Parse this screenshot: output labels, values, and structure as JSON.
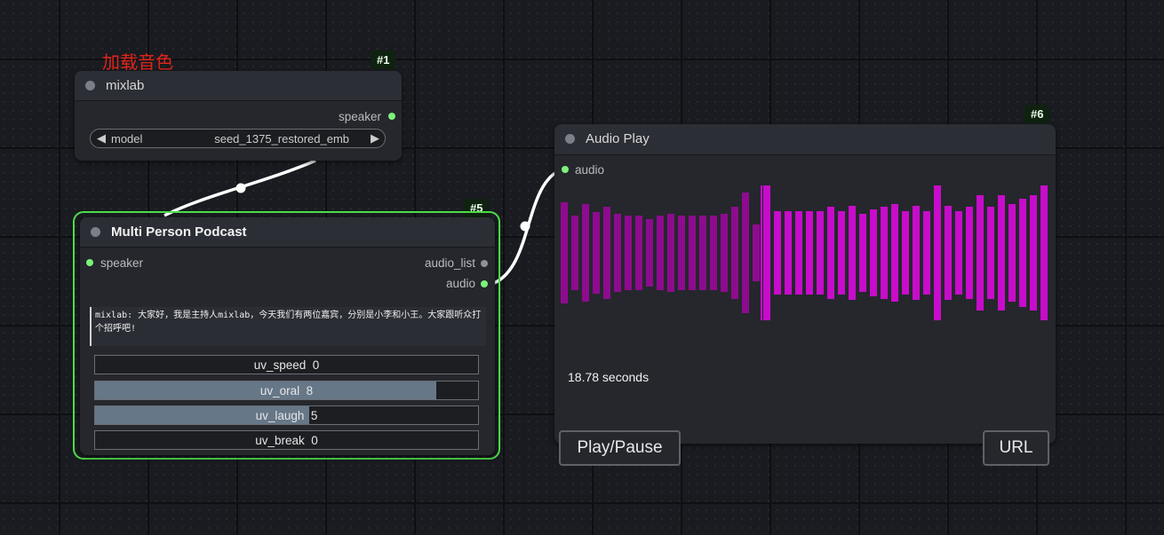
{
  "group": {
    "label": "加载音色"
  },
  "node1": {
    "badge": "#1",
    "title": "mixlab",
    "output": "speaker",
    "combo": {
      "label": "model",
      "value": "seed_1375_restored_emb"
    }
  },
  "node5": {
    "badge": "#5",
    "title": "Multi Person Podcast",
    "input": "speaker",
    "outputs": [
      "audio_list",
      "audio"
    ],
    "text": "mixlab: 大家好，我是主持人mixlab，今天我们有两位嘉宾，分别是小李和小王。大家跟听众打个招呼吧!",
    "sliders": [
      {
        "name": "uv_speed",
        "value": "0",
        "fraction": 0
      },
      {
        "name": "uv_oral",
        "value": "8",
        "fraction": 0.89
      },
      {
        "name": "uv_laugh",
        "value": "5",
        "fraction": 0.56
      },
      {
        "name": "uv_break",
        "value": "0",
        "fraction": 0
      }
    ]
  },
  "node6": {
    "badge": "#6",
    "title": "Audio Play",
    "input": "audio",
    "duration": "18.78 seconds",
    "play_label": "Play/Pause",
    "url_label": "URL",
    "played_color": "#8e0b8f",
    "unplayed_color": "#c70ccb",
    "waveform": [
      0.75,
      0.55,
      0.72,
      0.6,
      0.68,
      0.58,
      0.55,
      0.55,
      0.5,
      0.55,
      0.58,
      0.55,
      0.55,
      0.55,
      0.55,
      0.58,
      0.68,
      0.9,
      0.42,
      1.0,
      0.62,
      0.62,
      0.62,
      0.62,
      0.62,
      0.68,
      0.62,
      0.7,
      0.58,
      0.65,
      0.68,
      0.72,
      0.62,
      0.7,
      0.62,
      1.0,
      0.7,
      0.62,
      0.68,
      0.85,
      0.68,
      0.85,
      0.72,
      0.8,
      0.85,
      1.0
    ]
  },
  "colors": {
    "slot_green": "#7cf27a",
    "link": "#ffffff",
    "selected_outline": "#4ddc4a"
  }
}
